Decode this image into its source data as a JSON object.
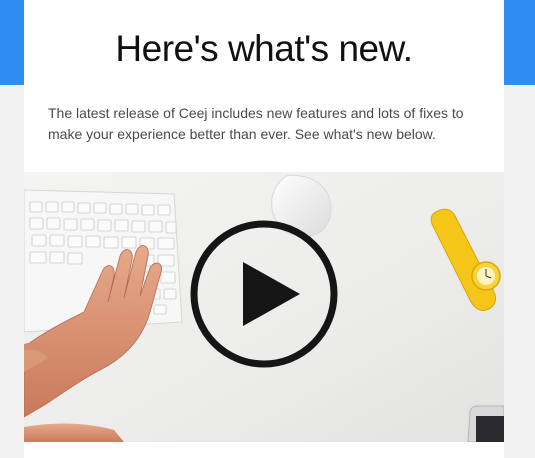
{
  "header": {
    "headline": "Here's what's new."
  },
  "intro": {
    "text": "The latest release of Ceej includes new features and lots of fixes to make your experience better than ever. See what's new below."
  },
  "video": {
    "play_icon": "play-circle-icon",
    "accent_color": "#2f8cf0"
  }
}
